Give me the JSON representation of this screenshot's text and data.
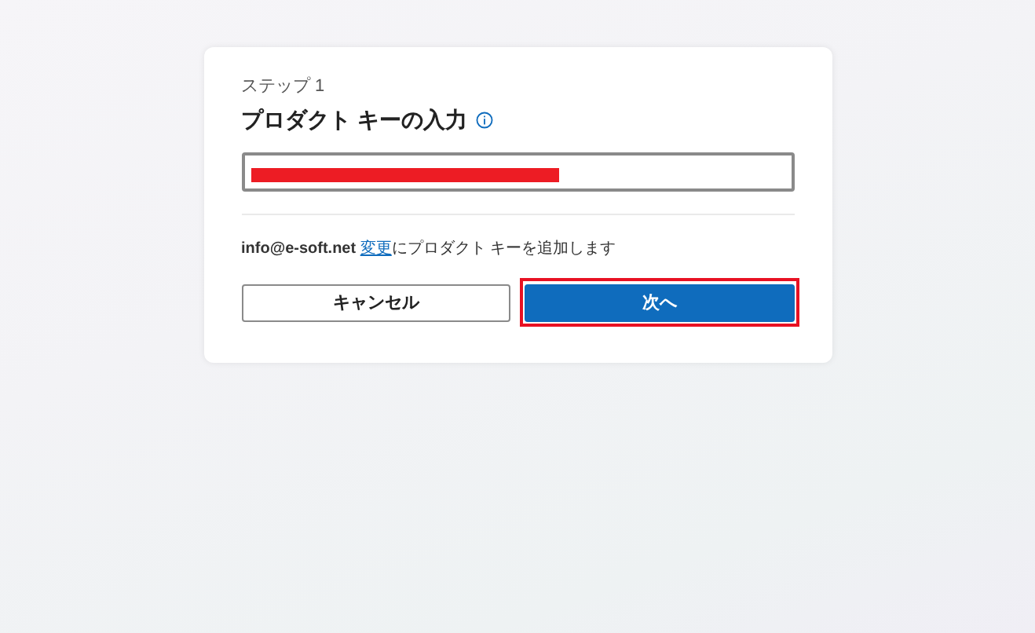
{
  "step_label": "ステップ 1",
  "title": "プロダクト キーの入力",
  "key_field": {
    "redacted": true
  },
  "notice": {
    "account": "info@e-soft.net",
    "link": "変更",
    "rest": "にプロダクト キーを追加します"
  },
  "buttons": [
    {
      "kind": "secondary",
      "label": "キャンセル",
      "highlighted": false
    },
    {
      "kind": "primary",
      "label": "次へ",
      "highlighted": true
    }
  ]
}
